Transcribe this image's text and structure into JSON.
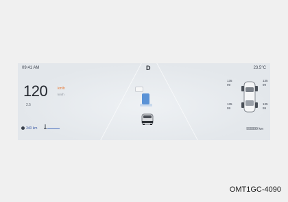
{
  "cluster": {
    "time": "09:41 AM",
    "gear": "D",
    "outside_temp": "23.5°C",
    "speed": "120",
    "drive_mode": "km/h",
    "speed_unit": "km/h",
    "trip": "2.5",
    "range": "340 km",
    "odometer": "999999 km",
    "tires": {
      "front_left": {
        "pressure": "135",
        "temp": "99"
      },
      "front_right": {
        "pressure": "135",
        "temp": "99"
      },
      "rear_left": {
        "pressure": "135",
        "temp": "99"
      },
      "rear_right": {
        "pressure": "135",
        "temp": "99"
      }
    },
    "colors": {
      "accent_blue": "#5a92d6",
      "mode_orange": "#e8742e",
      "background": "#e6eaee"
    }
  },
  "caption": "OMT1GC-4090"
}
